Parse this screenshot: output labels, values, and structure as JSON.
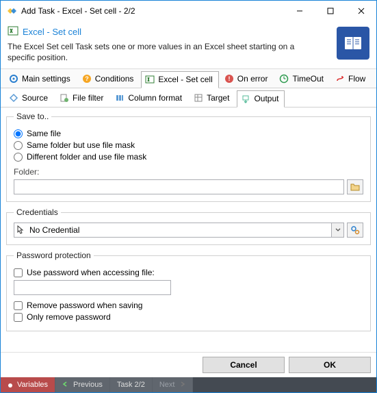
{
  "window": {
    "title": "Add Task - Excel - Set cell - 2/2"
  },
  "header": {
    "title": "Excel - Set cell",
    "description": "The Excel Set cell Task sets one or more values in an Excel sheet starting on a specific position."
  },
  "main_tabs": [
    {
      "label": "Main settings",
      "icon": "gear-blue"
    },
    {
      "label": "Conditions",
      "icon": "question-orange"
    },
    {
      "label": "Excel - Set cell",
      "icon": "excel-green",
      "active": true
    },
    {
      "label": "On error",
      "icon": "error-red"
    },
    {
      "label": "TimeOut",
      "icon": "timeout-green"
    },
    {
      "label": "Flow",
      "icon": "flow-red"
    }
  ],
  "sub_tabs": [
    {
      "label": "Source",
      "icon": "source"
    },
    {
      "label": "File filter",
      "icon": "filter"
    },
    {
      "label": "Column format",
      "icon": "columns"
    },
    {
      "label": "Target",
      "icon": "target"
    },
    {
      "label": "Output",
      "icon": "output",
      "active": true
    }
  ],
  "save_to": {
    "legend": "Save to..",
    "options": [
      {
        "label": "Same file",
        "checked": true
      },
      {
        "label": "Same folder but use file mask",
        "checked": false
      },
      {
        "label": "Different folder and use file mask",
        "checked": false
      }
    ],
    "folder_label": "Folder:",
    "folder_value": ""
  },
  "credentials": {
    "legend": "Credentials",
    "selected": "No Credential"
  },
  "password": {
    "legend": "Password protection",
    "use_label": "Use password when accessing file:",
    "use_checked": false,
    "value": "",
    "remove_label": "Remove password when saving",
    "remove_checked": false,
    "only_remove_label": "Only remove password",
    "only_remove_checked": false
  },
  "buttons": {
    "cancel": "Cancel",
    "ok": "OK"
  },
  "statusbar": {
    "variables": "Variables",
    "previous": "Previous",
    "task": "Task 2/2",
    "next": "Next"
  }
}
